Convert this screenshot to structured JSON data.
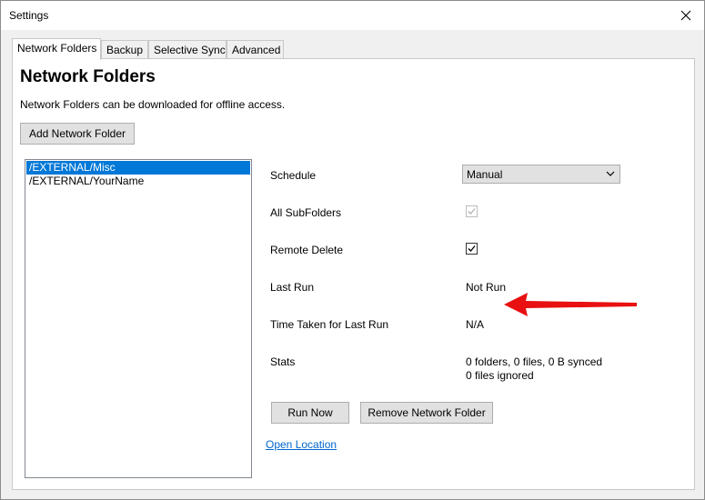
{
  "window": {
    "title": "Settings"
  },
  "tabs": [
    {
      "label": "Network Folders",
      "active": true
    },
    {
      "label": "Backup"
    },
    {
      "label": "Selective Sync"
    },
    {
      "label": "Advanced"
    }
  ],
  "panel": {
    "title": "Network Folders",
    "description": "Network Folders can be downloaded for offline access.",
    "add_button": "Add Network Folder"
  },
  "folders": [
    {
      "path": "/EXTERNAL/Misc",
      "selected": true
    },
    {
      "path": "/EXTERNAL/YourName"
    }
  ],
  "details": {
    "schedule_label": "Schedule",
    "schedule_value": "Manual",
    "all_subfolders_label": "All SubFolders",
    "all_subfolders_checked": true,
    "remote_delete_label": "Remote Delete",
    "remote_delete_checked": true,
    "last_run_label": "Last Run",
    "last_run_value": "Not Run",
    "time_taken_label": "Time Taken for Last Run",
    "time_taken_value": "N/A",
    "stats_label": "Stats",
    "stats_line1": "0 folders, 0 files, 0 B synced",
    "stats_line2": "0 files ignored"
  },
  "actions": {
    "run_now": "Run Now",
    "remove": "Remove Network Folder",
    "open_location": "Open Location"
  },
  "annotation": {
    "arrow_color": "#e81010"
  },
  "colors": {
    "selection": "#0078d7",
    "link": "#0066cc"
  }
}
